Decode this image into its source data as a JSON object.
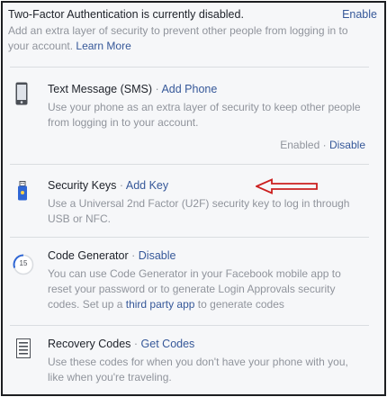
{
  "header": {
    "status_text": "Two-Factor Authentication is currently disabled.",
    "enable_link": "Enable",
    "description": "Add an extra layer of security to prevent other people from logging in to your account.",
    "learn_more": "Learn More"
  },
  "separator": "·",
  "sms": {
    "title": "Text Message (SMS)",
    "action": "Add Phone",
    "description": "Use your phone as an extra layer of security to keep other people from logging in to your account.",
    "status": "Enabled",
    "status_action": "Disable"
  },
  "security_keys": {
    "title": "Security Keys",
    "action": "Add Key",
    "description": "Use a Universal 2nd Factor (U2F) security key to log in through USB or NFC."
  },
  "code_generator": {
    "title": "Code Generator",
    "action": "Disable",
    "icon_number": "15",
    "description_part1": "You can use Code Generator in your Facebook mobile app to reset your password or to generate Login Approvals security codes. Set up a",
    "third_party_link": "third party app",
    "description_part2": "to generate codes"
  },
  "recovery_codes": {
    "title": "Recovery Codes",
    "action": "Get Codes",
    "description": "Use these codes for when you don't have your phone with you, like when you're traveling."
  },
  "colors": {
    "link": "#365899",
    "muted": "#90949c",
    "arrow": "#cc1f1f",
    "usb_blue": "#2f66d4"
  }
}
